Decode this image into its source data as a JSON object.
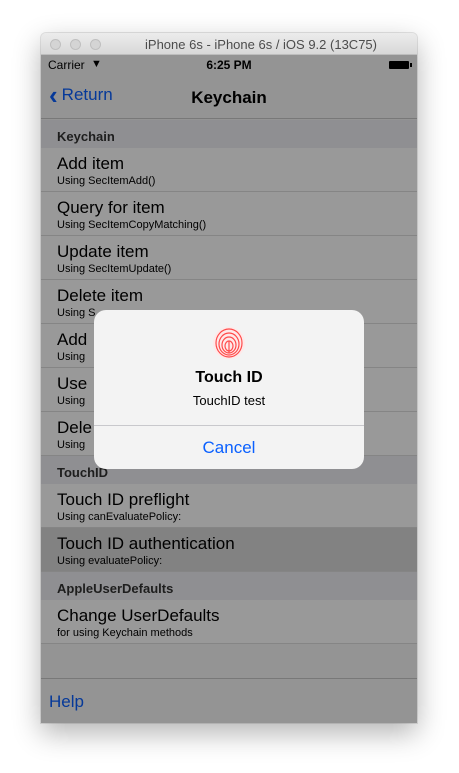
{
  "window": {
    "title": "iPhone 6s - iPhone 6s / iOS 9.2 (13C75)"
  },
  "status_bar": {
    "carrier": "Carrier",
    "time": "6:25 PM"
  },
  "nav": {
    "back_label": "Return",
    "title": "Keychain"
  },
  "sections": [
    {
      "header": "Keychain",
      "rows": [
        {
          "title": "Add item",
          "subtitle": "Using SecItemAdd()"
        },
        {
          "title": "Query for item",
          "subtitle": "Using SecItemCopyMatching()"
        },
        {
          "title": "Update item",
          "subtitle": "Using SecItemUpdate()"
        },
        {
          "title": "Delete item",
          "subtitle": "Using S"
        },
        {
          "title": "Add",
          "subtitle": "Using"
        },
        {
          "title": "Use",
          "subtitle": "Using"
        },
        {
          "title": "Dele",
          "subtitle": "Using"
        }
      ]
    },
    {
      "header": "TouchID",
      "rows": [
        {
          "title": "Touch ID preflight",
          "subtitle": "Using canEvaluatePolicy:"
        },
        {
          "title": "Touch ID authentication",
          "subtitle": "Using evaluatePolicy:"
        }
      ]
    },
    {
      "header": "AppleUserDefaults",
      "rows": [
        {
          "title": "Change UserDefaults",
          "subtitle": "for using Keychain methods"
        }
      ]
    }
  ],
  "toolbar": {
    "help_label": "Help"
  },
  "alert": {
    "icon": "fingerprint-icon",
    "title": "Touch ID",
    "message": "TouchID test",
    "cancel_label": "Cancel"
  },
  "colors": {
    "tint": "#0a60ff",
    "fingerprint": "#ff4b4b"
  }
}
